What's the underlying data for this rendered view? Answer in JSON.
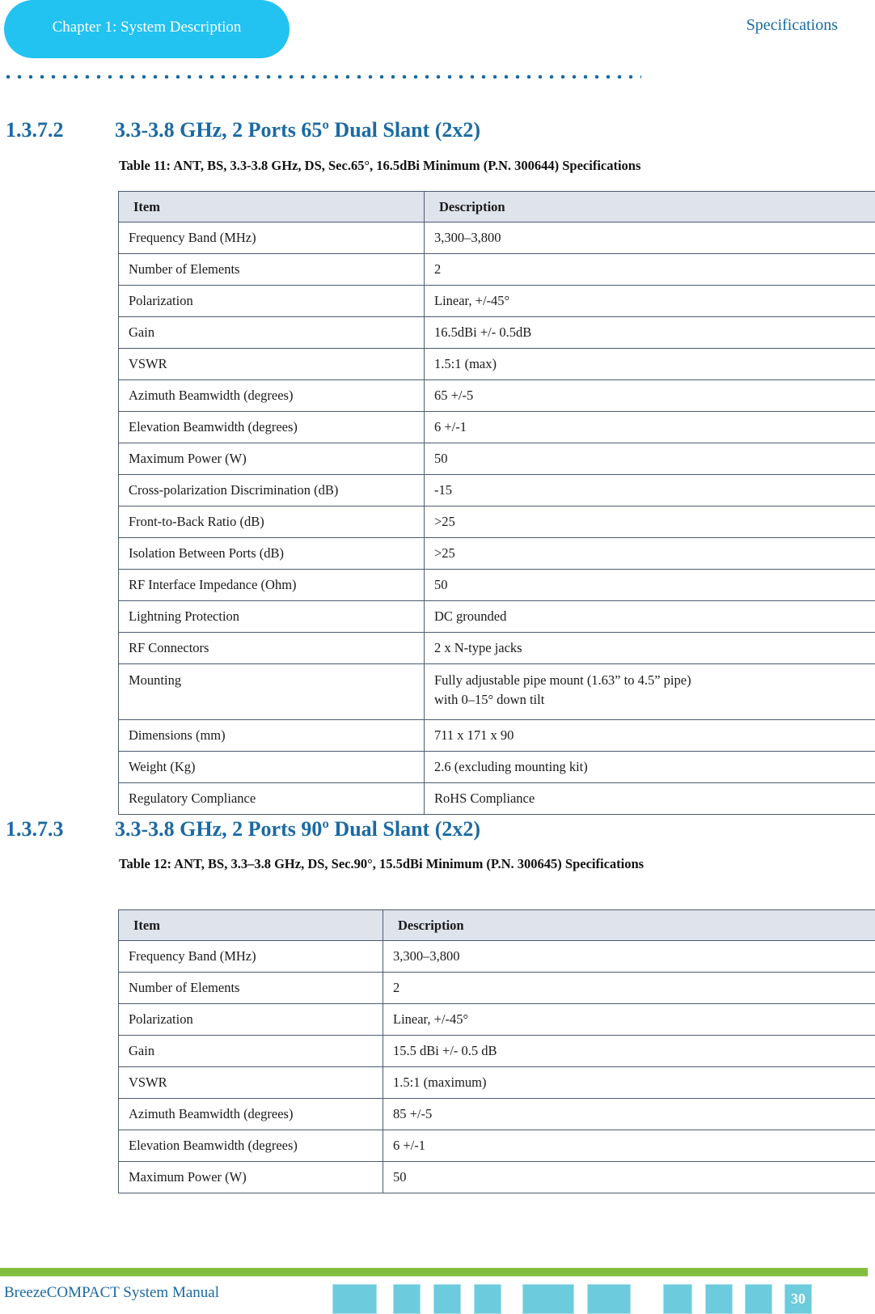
{
  "header": {
    "chapter_label": "Chapter 1: System Description",
    "section_label": "Specifications"
  },
  "sections": [
    {
      "number": "1.3.7.2",
      "title": "3.3-3.8 GHz, 2 Ports 65º Dual Slant (2x2)",
      "table_caption": "Table 11: ANT, BS, 3.3-3.8 GHz, DS, Sec.65°, 16.5dBi Minimum (P.N. 300644) Specifications",
      "columns": [
        "Item",
        "Description"
      ],
      "rows": [
        {
          "item": "Frequency Band (MHz)",
          "description": "3,300–3,800"
        },
        {
          "item": "Number of Elements",
          "description": "2"
        },
        {
          "item": "Polarization",
          "description": "Linear, +/-45°"
        },
        {
          "item": "Gain",
          "description": "16.5dBi +/- 0.5dB"
        },
        {
          "item": "VSWR",
          "description": "1.5:1 (max)"
        },
        {
          "item": "Azimuth Beamwidth (degrees)",
          "description": "65 +/-5"
        },
        {
          "item": "Elevation Beamwidth (degrees)",
          "description": "6 +/-1"
        },
        {
          "item": "Maximum Power (W)",
          "description": "50"
        },
        {
          "item": "Cross-polarization Discrimination (dB)",
          "description": "-15"
        },
        {
          "item": "Front-to-Back Ratio (dB)",
          "description": ">25"
        },
        {
          "item": "Isolation Between Ports (dB)",
          "description": ">25"
        },
        {
          "item": "RF Interface Impedance (Ohm)",
          "description": "50"
        },
        {
          "item": "Lightning Protection",
          "description": "DC grounded"
        },
        {
          "item": "RF Connectors",
          "description": "2 x N-type jacks"
        },
        {
          "item": "Mounting",
          "description": "Fully adjustable pipe mount (1.63” to 4.5” pipe)",
          "description_line2": "with 0–15° down tilt"
        },
        {
          "item": "Dimensions (mm)",
          "description": "711 x 171 x 90"
        },
        {
          "item": "Weight (Kg)",
          "description": "2.6 (excluding mounting kit)"
        },
        {
          "item": "Regulatory Compliance",
          "description": "RoHS Compliance"
        }
      ]
    },
    {
      "number": "1.3.7.3",
      "title": "3.3-3.8 GHz, 2 Ports 90º Dual Slant (2x2)",
      "table_caption": "Table 12: ANT, BS, 3.3–3.8 GHz, DS, Sec.90°, 15.5dBi Minimum (P.N. 300645) Specifications",
      "columns": [
        "Item",
        "Description"
      ],
      "rows": [
        {
          "item": "Frequency Band (MHz)",
          "description": "3,300–3,800"
        },
        {
          "item": "Number of Elements",
          "description": "2"
        },
        {
          "item": "Polarization",
          "description": "Linear, +/-45°"
        },
        {
          "item": "Gain",
          "description": "15.5 dBi +/- 0.5 dB"
        },
        {
          "item": "VSWR",
          "description": "1.5:1 (maximum)"
        },
        {
          "item": "Azimuth Beamwidth (degrees)",
          "description": "85 +/-5"
        },
        {
          "item": "Elevation Beamwidth (degrees)",
          "description": "6 +/-1"
        },
        {
          "item": "Maximum Power (W)",
          "description": "50"
        }
      ]
    }
  ],
  "footer": {
    "manual_title": "BreezeCOMPACT System Manual",
    "page_number": "30"
  },
  "colors": {
    "chapter_pill": "#22c2f1",
    "heading_blue": "#1b6aa3",
    "footer_green": "#82bd41",
    "footer_block": "#6ccbdc",
    "table_header_bg": "#dfe3ec"
  }
}
